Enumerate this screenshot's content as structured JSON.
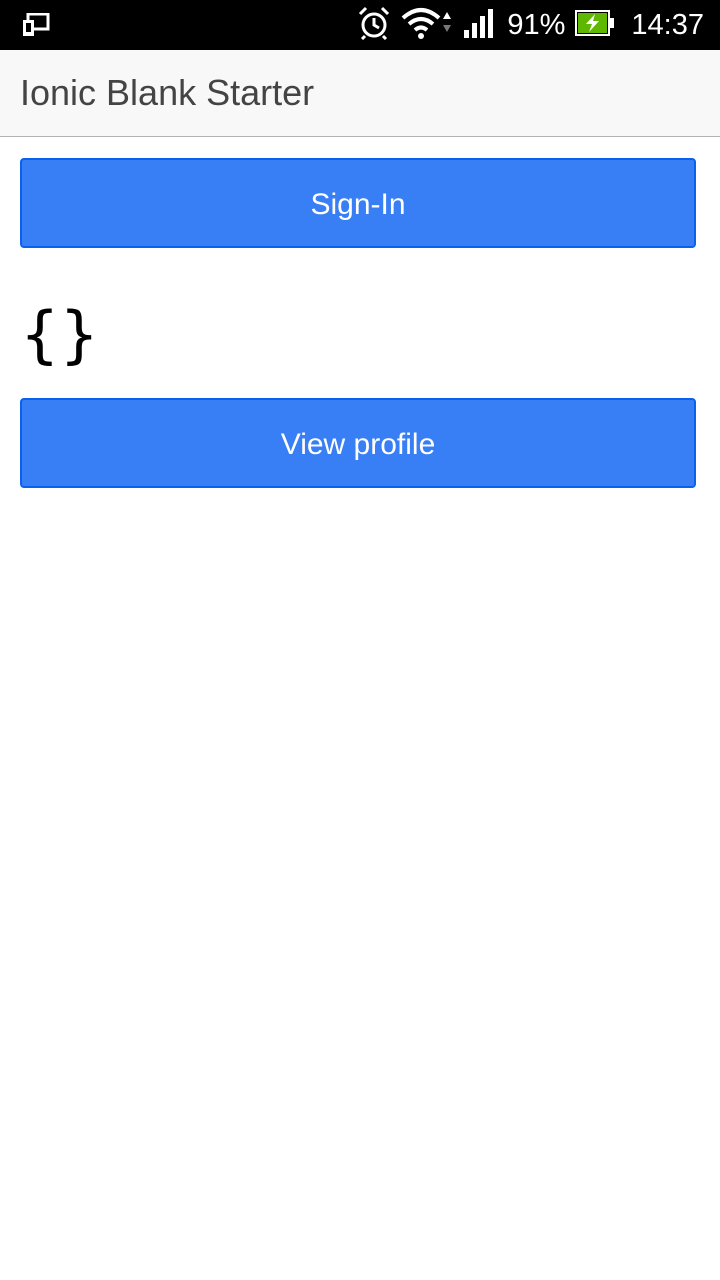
{
  "status_bar": {
    "battery_percent": "91%",
    "time": "14:37",
    "icons": {
      "device": "screen-mirror-icon",
      "alarm": "alarm-clock-icon",
      "wifi": "wifi-icon",
      "signal": "cell-signal-icon",
      "battery": "battery-charging-icon"
    },
    "battery_color": "#5fb800"
  },
  "header": {
    "title": "Ionic Blank Starter"
  },
  "main": {
    "sign_in_label": "Sign-In",
    "profile_output": "{}",
    "view_profile_label": "View profile"
  },
  "colors": {
    "button": "#387ef5",
    "button_border": "#0c60ee",
    "header_bg": "#f8f8f8"
  }
}
